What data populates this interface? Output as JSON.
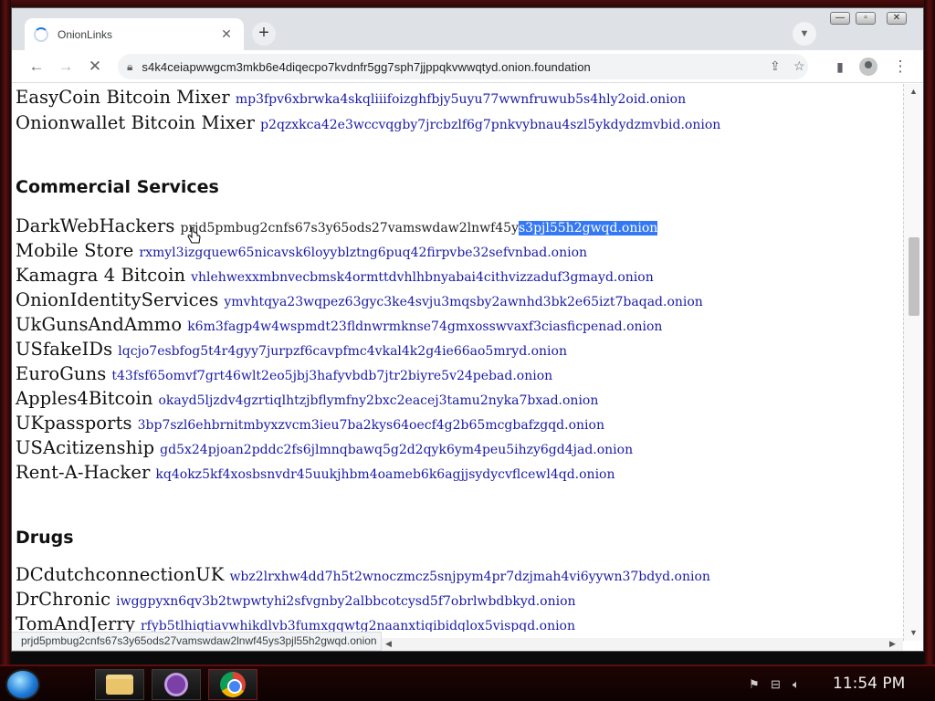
{
  "browser": {
    "tab_title": "OnionLinks",
    "url": "s4k4ceiapwwgcm3mkb6e4diqecpo7kvdnfr5gg7sph7jjppqkvwwqtyd.onion.foundation",
    "status_url": "prjd5pmbug2cnfs67s3y65ods27vamswdaw2lnwf45ys3pjl55h2gwqd.onion"
  },
  "page": {
    "top_links": [
      {
        "name": "EasyCoin Bitcoin Mixer",
        "onion": "mp3fpv6xbrwka4skqliiifoizghfbjy5uyu77wwnfruwub5s4hly2oid.onion"
      },
      {
        "name": "Onionwallet Bitcoin Mixer",
        "onion": "p2qzxkca42e3wccvqgby7jrcbzlf6g7pnkvybnau4szl5ykdydzmvbid.onion"
      }
    ],
    "commercial_heading": "Commercial Services",
    "darkweb": {
      "name": "DarkWebHackers",
      "onion_plain": "prjd5pmbug2cnfs67s3y65ods27vamswdaw2lnwf45y",
      "onion_selected": "s3pjl55h2gwqd.onion"
    },
    "commercial_links": [
      {
        "name": "Mobile Store",
        "onion": "rxmyl3izgquew65nicavsk6loyyblztng6puq42firpvbe32sefvnbad.onion"
      },
      {
        "name": "Kamagra 4 Bitcoin",
        "onion": "vhlehwexxmbnvecbmsk4ormttdvhlhbnyabai4cithvizzaduf3gmayd.onion"
      },
      {
        "name": "OnionIdentityServices",
        "onion": "ymvhtqya23wqpez63gyc3ke4svju3mqsby2awnhd3bk2e65izt7baqad.onion"
      },
      {
        "name": "UkGunsAndAmmo",
        "onion": "k6m3fagp4w4wspmdt23fldnwrmknse74gmxosswvaxf3ciasficpenad.onion"
      },
      {
        "name": "USfakeIDs",
        "onion": "lqcjo7esbfog5t4r4gyy7jurpzf6cavpfmc4vkal4k2g4ie66ao5mryd.onion"
      },
      {
        "name": "EuroGuns",
        "onion": "t43fsf65omvf7grt46wlt2eo5jbj3hafyvbdb7jtr2biyre5v24pebad.onion"
      },
      {
        "name": "Apples4Bitcoin",
        "onion": "okayd5ljzdv4gzrtiqlhtzjbflymfny2bxc2eacej3tamu2nyka7bxad.onion"
      },
      {
        "name": "UKpassports",
        "onion": "3bp7szl6ehbrnitmbyxzvcm3ieu7ba2kys64oecf4g2b65mcgbafzgqd.onion"
      },
      {
        "name": "USAcitizenship",
        "onion": "gd5x24pjoan2pddc2fs6jlmnqbawq5g2d2qyk6ym4peu5ihzy6gd4jad.onion"
      },
      {
        "name": "Rent-A-Hacker",
        "onion": "kq4okz5kf4xosbsnvdr45uukjhbm4oameb6k6agjjsydycvflcewl4qd.onion"
      }
    ],
    "drugs_heading": "Drugs",
    "drug_links": [
      {
        "name": "DCdutchconnectionUK",
        "onion": "wbz2lrxhw4dd7h5t2wnoczmcz5snjpym4pr7dzjmah4vi6yywn37bdyd.onion"
      },
      {
        "name": "DrChronic",
        "onion": "iwggpyxn6qv3b2twpwtyhi2sfvgnby2albbcotcysd5f7obrlwbdbkyd.onion"
      },
      {
        "name": "TomAndJerry",
        "onion": "rfyb5tlhiqtiavwhikdlvb3fumxgqwtg2naanxtiqibidqlox5vispqd.onion"
      }
    ]
  },
  "taskbar": {
    "clock": "11:54 PM"
  },
  "colors": {
    "link": "#1a1aa6",
    "selection": "#3478f6"
  }
}
